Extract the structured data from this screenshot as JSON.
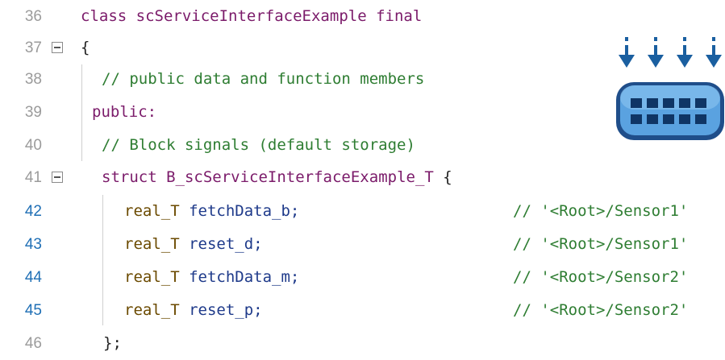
{
  "lines": [
    {
      "num": "36",
      "class_kw": "class",
      "class_name": "scServiceInterfaceExample",
      "final_kw": "final"
    },
    {
      "num": "37",
      "text": "{"
    },
    {
      "num": "38",
      "text": "// public data and function members"
    },
    {
      "num": "39",
      "text": "public:"
    },
    {
      "num": "40",
      "text": "// Block signals (default storage)"
    },
    {
      "num": "41",
      "struct_kw": "struct",
      "struct_name": "B_scServiceInterfaceExample_T",
      "brace": "{"
    },
    {
      "num": "42",
      "type": "real_T",
      "field": "fetchData_b;",
      "comment": "// '<Root>/Sensor1'"
    },
    {
      "num": "43",
      "type": "real_T",
      "field": "reset_d;",
      "comment": "// '<Root>/Sensor1'"
    },
    {
      "num": "44",
      "type": "real_T",
      "field": "fetchData_m;",
      "comment": "// '<Root>/Sensor2'"
    },
    {
      "num": "45",
      "type": "real_T",
      "field": "reset_p;",
      "comment": "// '<Root>/Sensor2'"
    },
    {
      "num": "46",
      "text": "};"
    }
  ],
  "colors": {
    "keyword": "#7b1b6a",
    "comment": "#2e7d32",
    "identifier": "#1e3a8a",
    "type": "#6b4a00",
    "line_number": "#9b9b9b",
    "line_number_highlight": "#1f6fb5",
    "icon_blue": "#1a5fa0"
  },
  "icon": {
    "name": "service-interface-block-icon"
  }
}
